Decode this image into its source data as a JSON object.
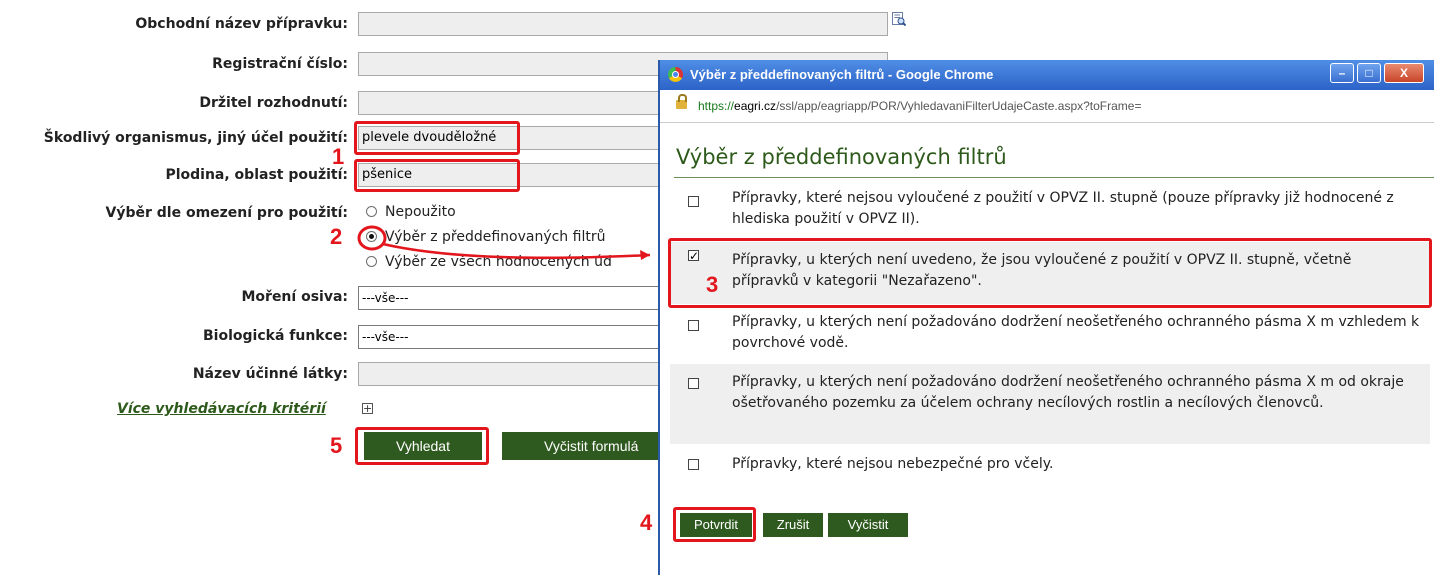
{
  "form": {
    "labels": {
      "name": "Obchodní název přípravku:",
      "reg": "Registrační číslo:",
      "holder": "Držitel rozhodnutí:",
      "pest": "Škodlivý organismus, jiný účel použití:",
      "crop": "Plodina, oblast použití:",
      "restriction": "Výběr dle omezení pro použití:",
      "seed": "Moření osiva:",
      "bio": "Biologická funkce:",
      "substance": "Název účinné látky:"
    },
    "values": {
      "name": "",
      "reg": "",
      "holder": "",
      "pest": "plevele dvouděložné",
      "crop": "pšenice",
      "seed": "---vše---",
      "bio": "---vše---",
      "substance": ""
    },
    "radios": {
      "unused": "Nepoužito",
      "predefined": "Výběr z předdefinovaných filtrů",
      "all": "Výběr ze všech hodnocených úd"
    },
    "more_criteria": "Více vyhledávacích kritérií",
    "search_button": "Vyhledat",
    "clear_button": "Vyčistit formulá"
  },
  "steps": [
    "1",
    "2",
    "3",
    "4",
    "5"
  ],
  "popup": {
    "window_title": "Výběr z předdefinovaných filtrů - Google Chrome",
    "url_scheme": "https://",
    "url_host": "eagri.cz",
    "url_path": "/ssl/app/eagriapp/POR/VyhledavaniFilterUdajeCaste.aspx?toFrame=",
    "title": "Výběr z předdefinovaných filtrů",
    "options": [
      {
        "text": "Přípravky, které nejsou vyloučené z použití v OPVZ II. stupně (pouze přípravky již hodnocené z hlediska použití v OPVZ II).",
        "checked": false
      },
      {
        "text": "Přípravky, u kterých není uvedeno, že jsou vyloučené z použití v OPVZ II. stupně, včetně přípravků v kategorii \"Nezařazeno\".",
        "checked": true
      },
      {
        "text": "Přípravky, u kterých není požadováno dodržení neošetřeného ochranného pásma X m vzhledem k povrchové vodě.",
        "checked": false
      },
      {
        "text": "Přípravky, u kterých není požadováno dodržení neošetřeného ochranného pásma X m od okraje ošetřovaného pozemku za účelem ochrany necílových rostlin a necílových členovců.",
        "checked": false
      },
      {
        "text": "Přípravky, které nejsou nebezpečné pro včely.",
        "checked": false
      }
    ],
    "confirm_button": "Potvrdit",
    "cancel_button": "Zrušit",
    "clear_button": "Vyčistit"
  },
  "colors": {
    "highlight": "#e2161c",
    "button_green": "#2f5a1f",
    "title_green": "#2d5a1b"
  }
}
